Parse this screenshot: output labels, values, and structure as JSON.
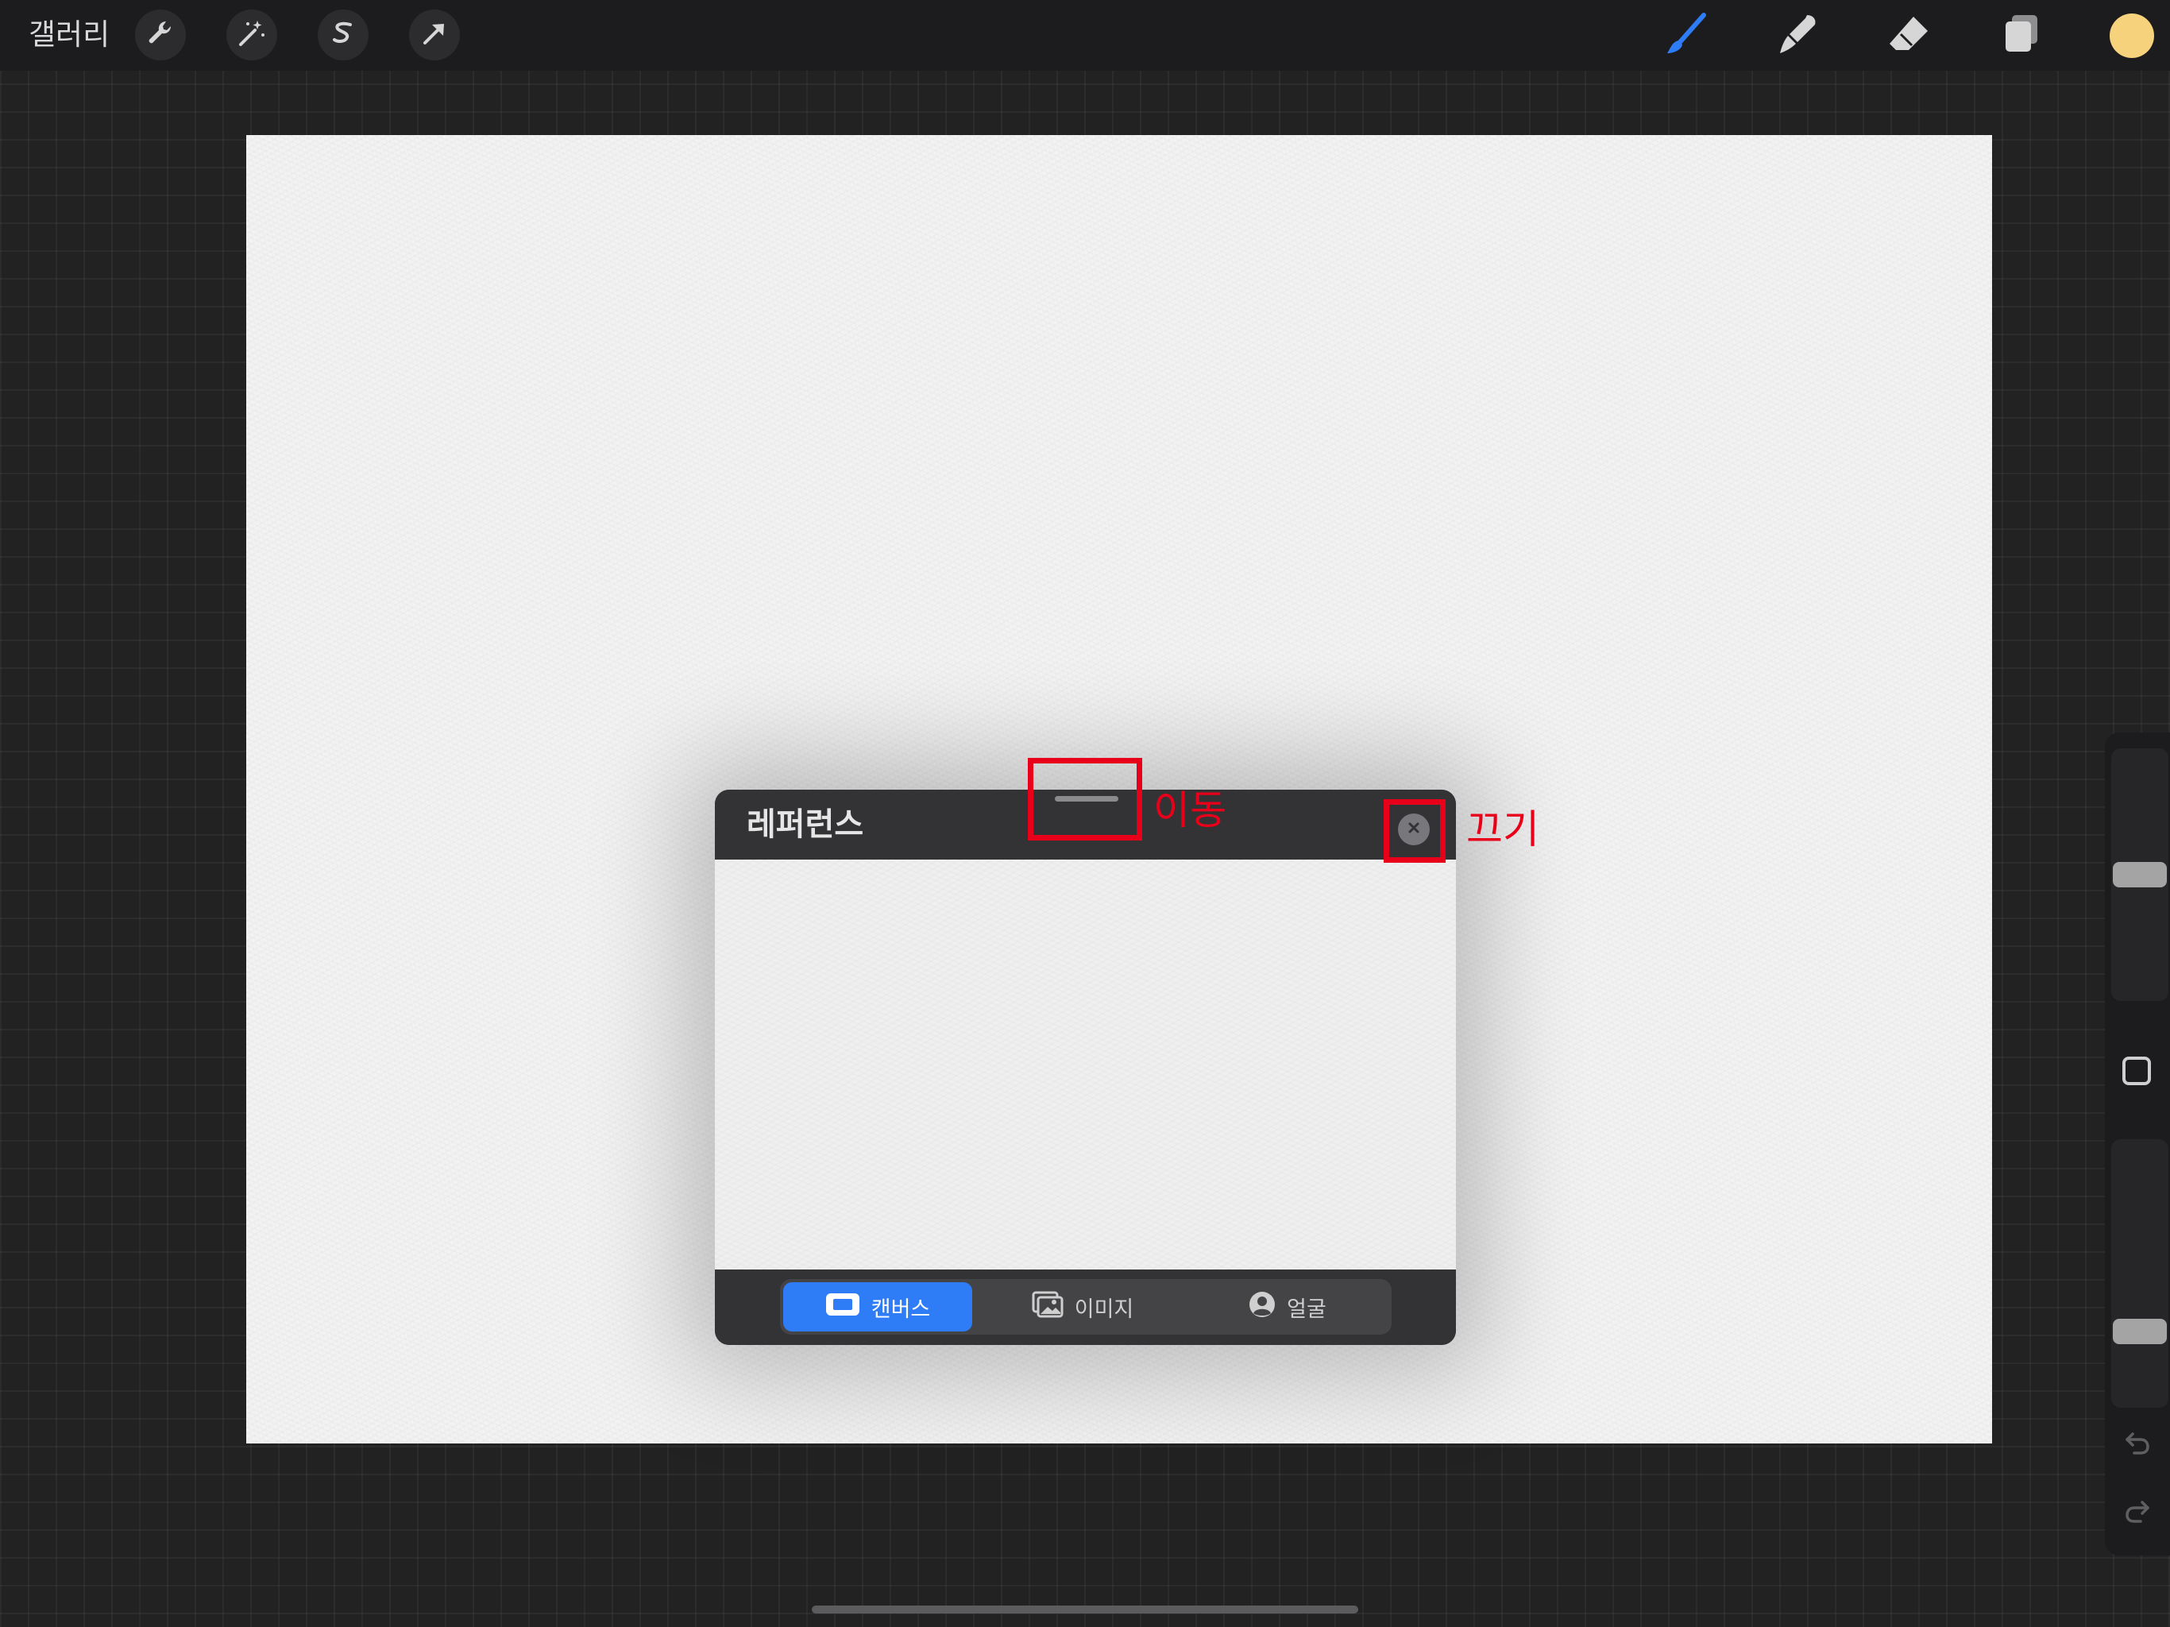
{
  "toolbar": {
    "gallery_label": "갤러리",
    "left_tools": [
      "wrench-icon",
      "magic-wand-icon",
      "selection-s-icon",
      "arrow-transform-icon"
    ],
    "right_tools": [
      "brush-icon",
      "smudge-icon",
      "eraser-icon",
      "layers-icon"
    ],
    "active_tool": "brush-icon",
    "active_tool_color": "#2e7cf6",
    "current_color": "#f7d27c"
  },
  "reference_panel": {
    "title": "레퍼런스",
    "tabs": [
      {
        "label": "캔버스",
        "icon": "canvas-icon",
        "active": true
      },
      {
        "label": "이미지",
        "icon": "image-icon",
        "active": false
      },
      {
        "label": "얼굴",
        "icon": "face-icon",
        "active": false
      }
    ],
    "accent_color": "#2e7cf6"
  },
  "annotations": {
    "move_label": "이동",
    "close_label": "끄기",
    "color": "#e8001b"
  },
  "sidebar": {
    "size_level": 0.5,
    "opacity_level": 0.25
  }
}
